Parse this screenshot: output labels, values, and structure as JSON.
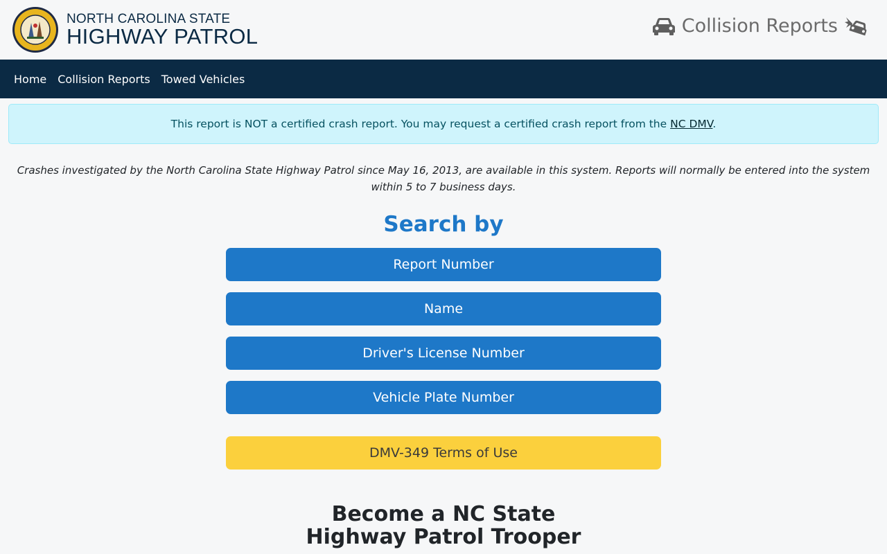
{
  "header": {
    "brand_top": "NORTH CAROLINA STATE",
    "brand_bottom": "HIGHWAY PATROL",
    "app_title": "Collision Reports",
    "seal_icon": "nc-highway-patrol-seal",
    "title_icons": [
      "car-icon",
      "car-crash-icon"
    ]
  },
  "nav": {
    "items": [
      {
        "label": "Home"
      },
      {
        "label": "Collision Reports"
      },
      {
        "label": "Towed Vehicles"
      }
    ]
  },
  "alert": {
    "text_before": "This report is NOT a certified crash report. You may request a certified crash report from the ",
    "link": "NC DMV",
    "text_after": "."
  },
  "intro": "Crashes investigated by the North Carolina State Highway Patrol since May 16, 2013, are available in this system. Reports will normally be entered into the system within 5 to 7 business days.",
  "search": {
    "heading": "Search by",
    "buttons": [
      {
        "label": "Report Number"
      },
      {
        "label": "Name"
      },
      {
        "label": "Driver's License Number"
      },
      {
        "label": "Vehicle Plate Number"
      }
    ],
    "terms_button": "DMV-349 Terms of Use"
  },
  "recruit": {
    "line1": "Become a NC State",
    "line2": "Highway Patrol Trooper"
  },
  "colors": {
    "navbar": "#0b2a44",
    "primary": "#1e78c8",
    "warning": "#fbd03d",
    "alert_bg": "#cff4fc"
  }
}
